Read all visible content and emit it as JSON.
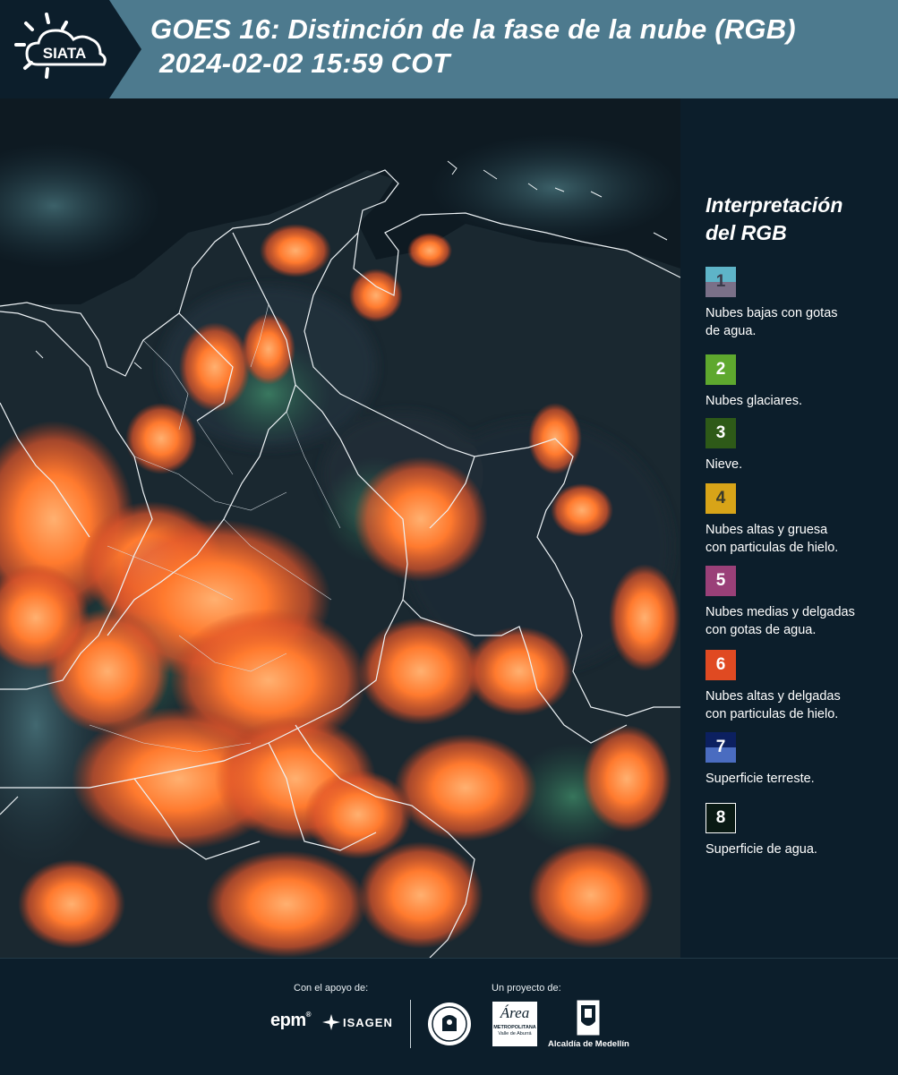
{
  "header": {
    "logo_text": "SIATA",
    "title_line1": "GOES 16: Distinción de la fase de la nube (RGB)",
    "title_line2": "2024-02-02 15:59 COT"
  },
  "legend": {
    "title_line1": "Interpretación",
    "title_line2": "del RGB",
    "items": [
      {
        "number": "1",
        "label_line1": "Nubes bajas con gotas",
        "label_line2": "de agua.",
        "color_top": "#5eb4c8",
        "color_bottom": "#7a7088",
        "text_color": "#3a3a4a"
      },
      {
        "number": "2",
        "label_line1": "Nubes glaciares.",
        "label_line2": "",
        "color_top": "#5ea82e",
        "color_bottom": "#5ea82e",
        "text_color": "#ffffff"
      },
      {
        "number": "3",
        "label_line1": "Nieve.",
        "label_line2": "",
        "color_top": "#2e5a18",
        "color_bottom": "#2e5a18",
        "text_color": "#ffffff"
      },
      {
        "number": "4",
        "label_line1": "Nubes altas y gruesa",
        "label_line2": "con particulas de hielo.",
        "color_top": "#d8a418",
        "color_bottom": "#d8a418",
        "text_color": "#3a3a2a"
      },
      {
        "number": "5",
        "label_line1": "Nubes medias y delgadas",
        "label_line2": "con gotas de agua.",
        "color_top": "#9a4078",
        "color_bottom": "#9a4078",
        "text_color": "#ffffff"
      },
      {
        "number": "6",
        "label_line1": "Nubes altas y delgadas",
        "label_line2": "con particulas de hielo.",
        "color_top": "#e04a22",
        "color_bottom": "#e04a22",
        "text_color": "#ffffff"
      },
      {
        "number": "7",
        "label_line1": "Superficie terreste.",
        "label_line2": "",
        "color_top": "#0c2060",
        "color_bottom": "#4a6cc0",
        "text_color": "#ffffff"
      },
      {
        "number": "8",
        "label_line1": "Superficie de agua.",
        "label_line2": "",
        "color_top": "#0a1a14",
        "color_bottom": "#0a1a14",
        "text_color": "#ffffff"
      }
    ]
  },
  "footer": {
    "support_label": "Con el apoyo de:",
    "project_label": "Un proyecto de:",
    "epm_text": "epm",
    "isagen_text": "ISAGEN",
    "area_text": "Área",
    "area_sub1": "METROPOLITANA",
    "area_sub2": "Valle de Aburrá",
    "alcaldia_text": "Alcaldía de Medellín"
  },
  "map": {
    "description_colors": {
      "water": "#0e1a22",
      "land": "#1c2a34",
      "cloud_high": "#ff7a2e",
      "cloud_edge": "#3aa06a",
      "border": "#e8eef2"
    }
  }
}
